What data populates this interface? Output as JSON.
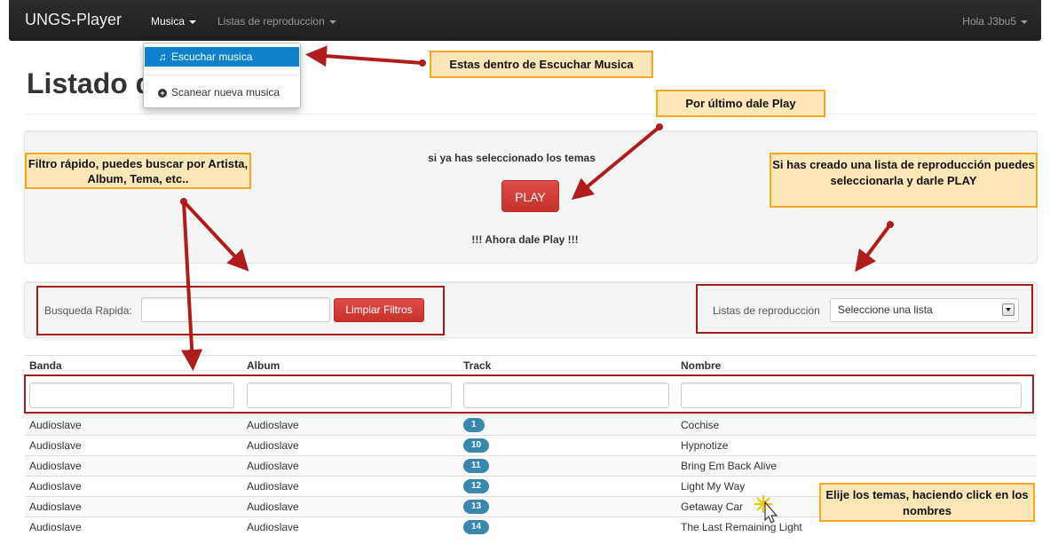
{
  "navbar": {
    "brand": "UNGS-Player",
    "menu_music": "Musica",
    "menu_playlists": "Listas de reproduccion",
    "user": "Hola J3bu5"
  },
  "dropdown": {
    "item_listen": "Escuchar musica",
    "item_scan": "Scanear nueva musica"
  },
  "page": {
    "title": "Listado de"
  },
  "play_panel": {
    "prompt": "si ya has seleccionado los temas",
    "play_label": "PLAY",
    "hint": "!!! Ahora dale Play !!!"
  },
  "filter_panel": {
    "search_label": "Busqueda Rapida:",
    "search_value": "",
    "clear_label": "Limpiar Filtros",
    "playlist_label": "Listas de reproduccion",
    "playlist_selected": "Seleccione una lista"
  },
  "table": {
    "headers": [
      "Banda",
      "Album",
      "Track",
      "Nombre"
    ],
    "rows": [
      {
        "band": "Audioslave",
        "album": "Audioslave",
        "track": "1",
        "name": "Cochise"
      },
      {
        "band": "Audioslave",
        "album": "Audioslave",
        "track": "10",
        "name": "Hypnotize"
      },
      {
        "band": "Audioslave",
        "album": "Audioslave",
        "track": "11",
        "name": "Bring Em Back Alive"
      },
      {
        "band": "Audioslave",
        "album": "Audioslave",
        "track": "12",
        "name": "Light My Way"
      },
      {
        "band": "Audioslave",
        "album": "Audioslave",
        "track": "13",
        "name": "Getaway Car"
      },
      {
        "band": "Audioslave",
        "album": "Audioslave",
        "track": "14",
        "name": "The Last Remaining Light"
      }
    ]
  },
  "annotations": {
    "dropdown_note": "Estas dentro de Escuchar Musica",
    "play_note": "Por último dale Play",
    "filter_note": "Filtro rápido, puedes buscar por Artista, Album, Tema, etc..",
    "playlist_note": "Si has creado una lista de reproducción puedes seleccionarla y darle PLAY",
    "select_note": "Elije los temas, haciendo click en los nombres"
  },
  "colors": {
    "navbar": "#222222",
    "dropdown_active": "#0f81cc",
    "danger": "#d9534f",
    "badge": "#3a87ad",
    "callout_fill": "#fde7b8",
    "callout_border": "#f5a623",
    "arrow": "#b01c1c"
  },
  "icons": {
    "listen": "music-note-icon",
    "scan": "plus-circle-icon",
    "cursor": "mouse-pointer-icon"
  }
}
